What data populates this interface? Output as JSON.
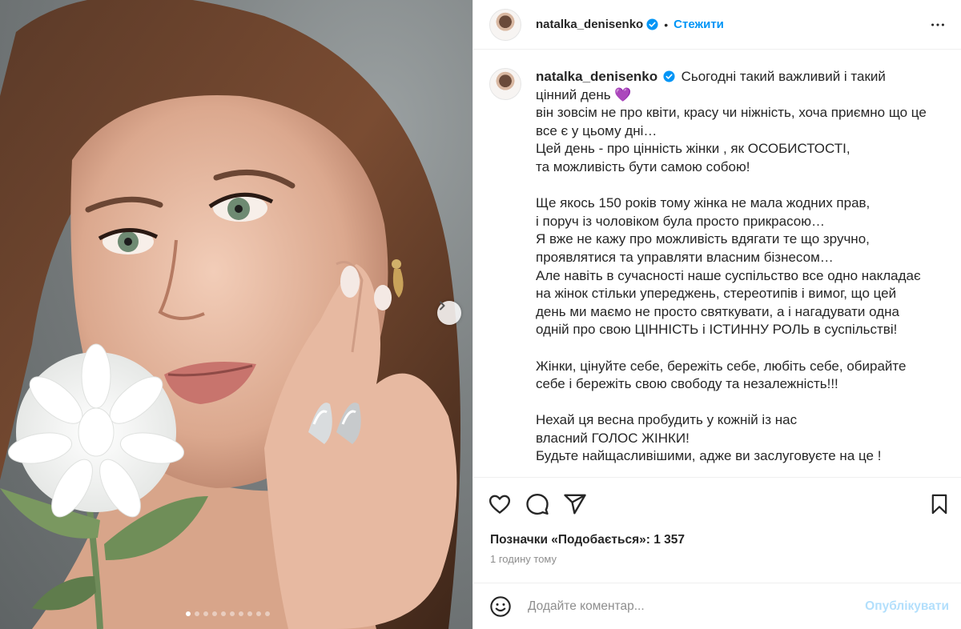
{
  "photo": {
    "alt_icon": "chevron-right-icon",
    "carousel_total": 10,
    "carousel_active": 1
  },
  "header": {
    "username": "natalka_denisenko",
    "separator": "•",
    "follow_label": "Стежити",
    "more_icon": "more-horizontal-icon"
  },
  "caption": {
    "username": "natalka_denisenko",
    "lines": [
      "Сьогодні такий важливий і такий цінний день 💜",
      "він зовсім не про квіти, красу чи ніжність, хоча приємно що це все є у цьому дні…",
      "Цей день - про цінність жінки , як ОСОБИСТОСТІ,",
      "та можливість бути самою собою!",
      "",
      "Ще якось 150 років тому жінка не мала жодних прав,",
      "і поруч із чоловіком була просто прикрасою…",
      "Я вже не кажу про можливість вдягати те що зручно,",
      "проявлятися та управляти власним бізнесом…",
      "Але навіть в сучасності наше суспільство все одно накладає на жінок стільки упереджень, стереотипів і вимог, що цей день ми маємо не просто святкувати, а і нагадувати одна одній про свою ЦІННІСТЬ і ІСТИННУ РОЛЬ в суспільстві!",
      "",
      "Жінки, цінуйте себе, бережіть себе, любіть себе, обирайте себе і бережіть свою свободу та незалежність!!!",
      "",
      "Нехай ця весна пробудить у кожній із нас",
      "власний ГОЛОС ЖІНКИ!",
      "Будьте найщасливішими, адже ви заслуговуєте на це !"
    ]
  },
  "actions": {
    "like_icon": "heart-icon",
    "comment_icon": "comment-icon",
    "share_icon": "share-icon",
    "save_icon": "bookmark-icon"
  },
  "likes_text": "Позначки «Подобається»: 1 357",
  "time_text": "1 годину тому",
  "comment": {
    "emoji_icon": "emoji-icon",
    "placeholder": "Додайте коментар...",
    "publish_label": "Опублікувати"
  },
  "colors": {
    "accent": "#0095f6",
    "publish_disabled": "#b2dffc",
    "verified": "#0095f6"
  }
}
